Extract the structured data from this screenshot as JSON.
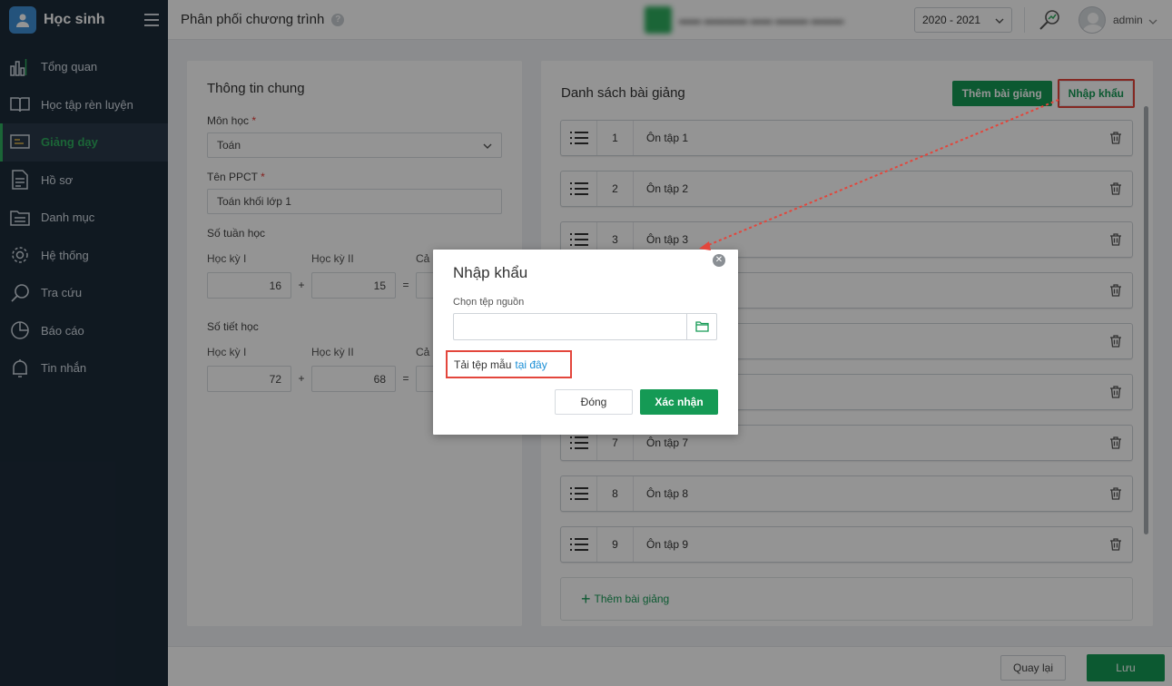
{
  "sidebar": {
    "app_title": "Học sinh",
    "items": [
      {
        "label": "Tổng quan",
        "icon": "bar-chart-icon"
      },
      {
        "label": "Học tập rèn luyện",
        "icon": "book-icon"
      },
      {
        "label": "Giảng dạy",
        "icon": "teaching-board-icon",
        "active": true
      },
      {
        "label": "Hồ sơ",
        "icon": "document-icon"
      },
      {
        "label": "Danh mục",
        "icon": "folder-icon"
      },
      {
        "label": "Hệ thống",
        "icon": "gear-icon"
      },
      {
        "label": "Tra cứu",
        "icon": "search-icon"
      },
      {
        "label": "Báo cáo",
        "icon": "pie-chart-icon"
      },
      {
        "label": "Tin nhắn",
        "icon": "bell-icon"
      }
    ]
  },
  "header": {
    "page_title": "Phân phối chương trình",
    "school_year": "2020 - 2021",
    "user_name": "admin"
  },
  "general": {
    "title": "Thông tin chung",
    "subject_label": "Môn học",
    "subject_value": "Toán",
    "ppct_label": "Tên PPCT",
    "ppct_value": "Toán khối lớp 1",
    "weeks_title": "Số tuần học",
    "semester1_label": "Học kỳ I",
    "semester2_label": "Học kỳ II",
    "total_label": "Cả",
    "weeks_s1": "16",
    "weeks_s2": "15",
    "periods_title": "Số tiết học",
    "periods_s1": "72",
    "periods_s2": "68",
    "plus": "+",
    "equals": "="
  },
  "lessons_panel": {
    "title": "Danh sách bài giảng",
    "add_button": "Thêm bài giảng",
    "import_button": "Nhập khẩu",
    "add_row_label": "Thêm bài giảng",
    "items": [
      {
        "num": "1",
        "name": "Ôn tập 1"
      },
      {
        "num": "2",
        "name": "Ôn tập 2"
      },
      {
        "num": "3",
        "name": "Ôn tập 3"
      },
      {
        "num": "",
        "name": ""
      },
      {
        "num": "",
        "name": ""
      },
      {
        "num": "",
        "name": ""
      },
      {
        "num": "7",
        "name": "Ôn tập 7"
      },
      {
        "num": "8",
        "name": "Ôn tập 8"
      },
      {
        "num": "9",
        "name": "Ôn tập 9"
      }
    ]
  },
  "footer": {
    "back_label": "Quay lại",
    "save_label": "Lưu"
  },
  "modal": {
    "title": "Nhập khẩu",
    "source_label": "Chọn tệp nguồn",
    "template_text": "Tải tệp mẫu",
    "template_link": "tại đây",
    "cancel_label": "Đóng",
    "confirm_label": "Xác nhận"
  },
  "colors": {
    "primary_green": "#159a55",
    "sidebar_bg": "#1d2b3a",
    "highlight_red": "#e3463c",
    "link_blue": "#1a8fd6"
  }
}
